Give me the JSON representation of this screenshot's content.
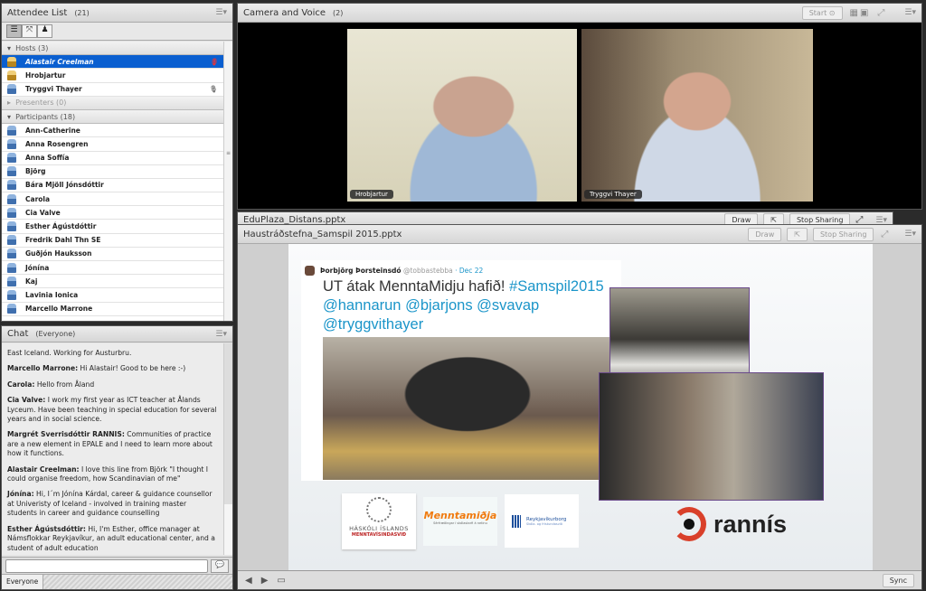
{
  "attendee": {
    "title": "Attendee List",
    "count": "(21)",
    "hosts_label": "Hosts (3)",
    "presenters_label": "Presenters (0)",
    "participants_label": "Participants (18)",
    "hosts": [
      "Alastair Creelman",
      "Hrobjartur",
      "Tryggvi Thayer"
    ],
    "participants": [
      "Ann-Catherine",
      "Anna Rosengren",
      "Anna Soffía",
      "Björg",
      "Bára Mjöll Jónsdóttir",
      "Carola",
      "Cia Valve",
      "Esther Ágústdóttir",
      "Fredrik Dahl Thn SE",
      "Guðjón Hauksson",
      "Jónína",
      "Kaj",
      "Lavinia Ionica",
      "Marcello Marrone"
    ]
  },
  "chat": {
    "title": "Chat",
    "scope": "(Everyone)",
    "tab": "Everyone",
    "input_value": "",
    "messages": [
      {
        "author": "",
        "text": "East Iceland. Working for Austurbru."
      },
      {
        "author": "Marcello Marrone:",
        "text": " Hi Alastair! Good to be here :-)"
      },
      {
        "author": "Carola:",
        "text": " Hello from Åland"
      },
      {
        "author": "Cia Valve:",
        "text": " I work my first year as ICT teacher at Ålands Lyceum. Have been teaching in special education for several years and in social science."
      },
      {
        "author": "Margrét Sverrisdóttir RANNIS:",
        "text": " Communities of practice are a new element in EPALE and I need to learn more about how it functions."
      },
      {
        "author": "Alastair Creelman:",
        "text": " I love this line from Björk \"I thought I could organise freedom, how Scandinavian of me\""
      },
      {
        "author": "Jónína:",
        "text": " Hi, I´m Jónína Kárdal, career & guidance counsellor at Univeristy of Iceland - involved in training master students in career and guidance counselling"
      },
      {
        "author": "Esther Ágústsdóttir:",
        "text": " Hi, I'm Esther, office manager at Námsflokkar Reykjavíkur, an adult educational center, and a student of adult education"
      }
    ]
  },
  "camera": {
    "title": "Camera and Voice",
    "count": "(2)",
    "start_label": "Start",
    "videos": [
      "Hrobjartur",
      "Tryggvi Thayer"
    ]
  },
  "share_back": {
    "title": "EduPlaza_Distans.pptx",
    "draw": "Draw",
    "stop": "Stop Sharing"
  },
  "share": {
    "title": "Haustráðstefna_Samspil 2015.pptx",
    "draw": "Draw",
    "stop": "Stop Sharing",
    "sync": "Sync"
  },
  "slide": {
    "tweet_author": "Þorbjörg Þorsteinsdó",
    "tweet_handle": "@tobbastebba",
    "tweet_date": "· Dec 22",
    "tweet_text": "UT átak MenntaMidju hafið! ",
    "tweet_tag": "#Samspil2015",
    "tweet_mentions": "@hannarun @bjarjons @svavap @tryggvithayer",
    "logo1_a": "HÁSKÓLI ÍSLANDS",
    "logo1_b": "MENNTAVÍSINDASVIÐ",
    "logo2": "Menntamiðja",
    "logo2_sub": "Sérfræðingar í skólastarfi á netinu",
    "logo3_a": "Reykjavíkurborg",
    "logo3_b": "Skóla- og frístundasvið",
    "logo4": "rannís"
  },
  "colors": {
    "selection": "#0a5fd0",
    "link": "#1b95c9",
    "accent_orange": "#f07b0f",
    "rannis_red": "#d9402a"
  }
}
